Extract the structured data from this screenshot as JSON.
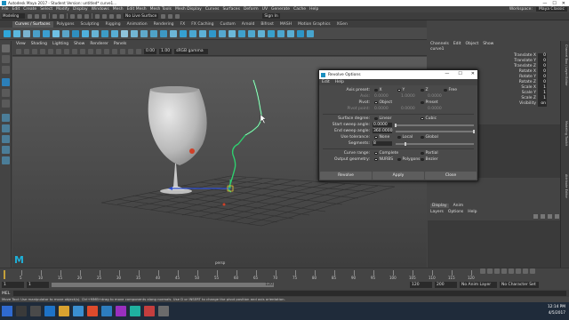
{
  "window": {
    "title": "Autodesk Maya 2017 - Student Version: untitled*    curve1...",
    "minimize": "—",
    "maximize": "☐",
    "close": "✕"
  },
  "menubar": {
    "items": [
      "File",
      "Edit",
      "Create",
      "Select",
      "Modify",
      "Display",
      "Windows",
      "Mesh",
      "Edit Mesh",
      "Mesh Tools",
      "Mesh Display",
      "Curves",
      "Surfaces",
      "Deform",
      "UV",
      "Generate",
      "Cache",
      "Help"
    ],
    "workspace_label": "Workspace:",
    "workspace_value": "Maya Classic"
  },
  "statusline": {
    "mode": "Modeling",
    "surface": "No Live Surface",
    "sign_in": "Sign In"
  },
  "shelf": {
    "tabs": [
      "Curves / Surfaces",
      "Polygons",
      "Sculpting",
      "Rigging",
      "Animation",
      "Rendering",
      "FX",
      "FX Caching",
      "Custom",
      "Arnold",
      "Bifrost",
      "MASH",
      "Motion Graphics",
      "XGen"
    ],
    "active_tab": "Curves / Surfaces"
  },
  "viewport": {
    "menu": [
      "View",
      "Shading",
      "Lighting",
      "Show",
      "Renderer",
      "Panels"
    ],
    "field_a": "0.00",
    "field_b": "1.00",
    "color_space": "sRGB gamma",
    "camera": "persp",
    "logo": "M"
  },
  "channelbox": {
    "tabs": [
      "Channels",
      "Edit",
      "Object",
      "Show"
    ],
    "object_name": "curve1",
    "channels": [
      {
        "name": "Translate X",
        "value": "0"
      },
      {
        "name": "Translate Y",
        "value": "0"
      },
      {
        "name": "Translate Z",
        "value": "0"
      },
      {
        "name": "Rotate X",
        "value": "0"
      },
      {
        "name": "Rotate Y",
        "value": "0"
      },
      {
        "name": "Rotate Z",
        "value": "0"
      },
      {
        "name": "Scale X",
        "value": "1"
      },
      {
        "name": "Scale Y",
        "value": "1"
      },
      {
        "name": "Scale Z",
        "value": "1"
      },
      {
        "name": "Visibility",
        "value": "on"
      }
    ],
    "side_tabs": [
      "Channel Box / Layer Editor",
      "Modeling Toolkit",
      "Attribute Editor"
    ]
  },
  "layers": {
    "tabs": [
      "Display",
      "Anim"
    ],
    "active_tab": "Display",
    "menu": [
      "Layers",
      "Options",
      "Help"
    ]
  },
  "dialog": {
    "title": "Revolve Options",
    "menu": [
      "Edit",
      "Help"
    ],
    "axis_preset": {
      "label": "Axis preset:",
      "options": [
        "X",
        "Y",
        "Z",
        "Free"
      ],
      "selected": "Y"
    },
    "axis": {
      "label": "Axis:",
      "values": [
        "0.0000",
        "1.0000",
        "0.0000"
      ]
    },
    "pivot": {
      "label": "Pivot:",
      "options": [
        "Object",
        "Preset"
      ],
      "selected": "Object"
    },
    "pivot_point": {
      "label": "Pivot point:",
      "values": [
        "0.0000",
        "0.0000",
        "0.0000"
      ]
    },
    "surface_degree": {
      "label": "Surface degree:",
      "options": [
        "Linear",
        "Cubic"
      ],
      "selected": "Cubic"
    },
    "start_sweep": {
      "label": "Start sweep angle:",
      "value": "0.0000",
      "fraction": 0.0
    },
    "end_sweep": {
      "label": "End sweep angle:",
      "value": "360.0000",
      "fraction": 1.0
    },
    "tolerance": {
      "label": "Use tolerance:",
      "options": [
        "None",
        "Local",
        "Global"
      ],
      "selected": "None"
    },
    "segments": {
      "label": "Segments:",
      "value": "8",
      "fraction": 0.12
    },
    "curve_range": {
      "label": "Curve range:",
      "options": [
        "Complete",
        "Partial"
      ],
      "selected": "Complete"
    },
    "output_geometry": {
      "label": "Output geometry:",
      "options": [
        "NURBS",
        "Polygons",
        "Bezier"
      ],
      "selected": "NURBS"
    },
    "buttons": [
      "Revolve",
      "Apply",
      "Close"
    ]
  },
  "timeline": {
    "ticks": [
      "5",
      "10",
      "15",
      "20",
      "25",
      "30",
      "35",
      "40",
      "45",
      "50",
      "55",
      "60",
      "65",
      "70",
      "75",
      "80",
      "85",
      "90",
      "95",
      "100",
      "105",
      "110",
      "115",
      "120"
    ],
    "current_frame": "1"
  },
  "range": {
    "start": "1",
    "inner_start": "1",
    "slider_start": "1",
    "slider_end": "120",
    "inner_end": "120",
    "end": "200",
    "anim_layer": "No Anim Layer",
    "char_set": "No Character Set",
    "fps": "24 fps"
  },
  "mel": {
    "label": "MEL"
  },
  "help": {
    "text": "Move Tool: Use manipulator to move object(s). Ctrl+MMB+drag to move components along normals. Use D or INSERT to change the pivot position and axis orientation."
  },
  "taskbar": {
    "time": "12:14 PM",
    "date": "4/5/2017"
  },
  "colors": {
    "accent": "#1b8fbf",
    "curve": "#2fcf6f",
    "glass": "#c8c8c8"
  }
}
